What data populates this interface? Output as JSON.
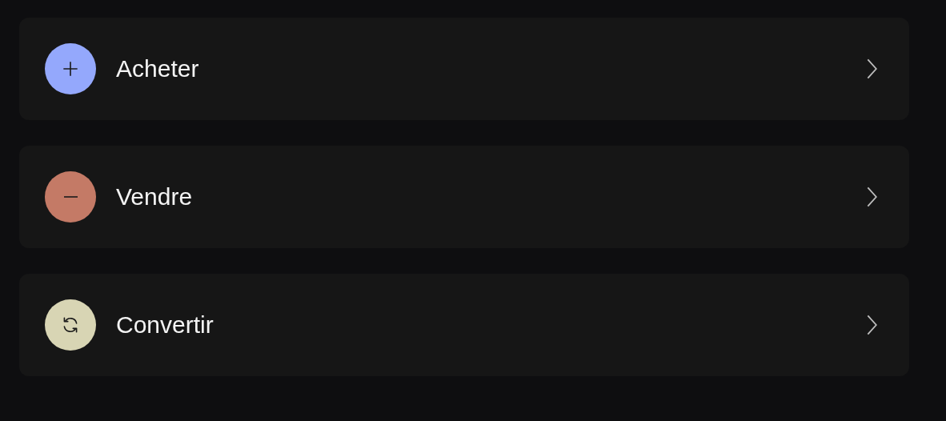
{
  "actions": [
    {
      "kind": "plus",
      "label": "Acheter",
      "color": "#94a8fc"
    },
    {
      "kind": "minus",
      "label": "Vendre",
      "color": "#c47a66"
    },
    {
      "kind": "convert",
      "label": "Convertir",
      "color": "#d8d5b4"
    }
  ]
}
